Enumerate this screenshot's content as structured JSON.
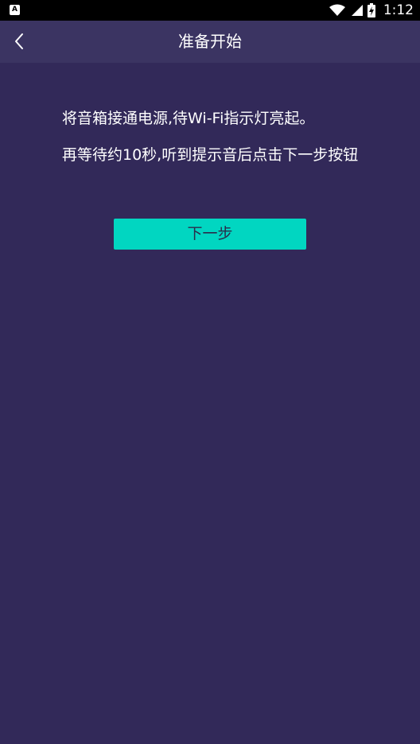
{
  "status_bar": {
    "app_icon_letter": "A",
    "time": "1:12",
    "icons": [
      "notification-a-icon",
      "wifi-icon",
      "signal-icon",
      "battery-icon"
    ]
  },
  "app_bar": {
    "title": "准备开始",
    "back_icon": "chevron-left-icon"
  },
  "instructions": {
    "line1": "将音箱接通电源,待Wi-Fi指示灯亮起。",
    "line2": "再等待约10秒,听到提示音后点击下一步按钮"
  },
  "next_button": {
    "label": "下一步"
  },
  "colors": {
    "background": "#322959",
    "app_bar": "#3b3462",
    "accent": "#01d6c1"
  }
}
